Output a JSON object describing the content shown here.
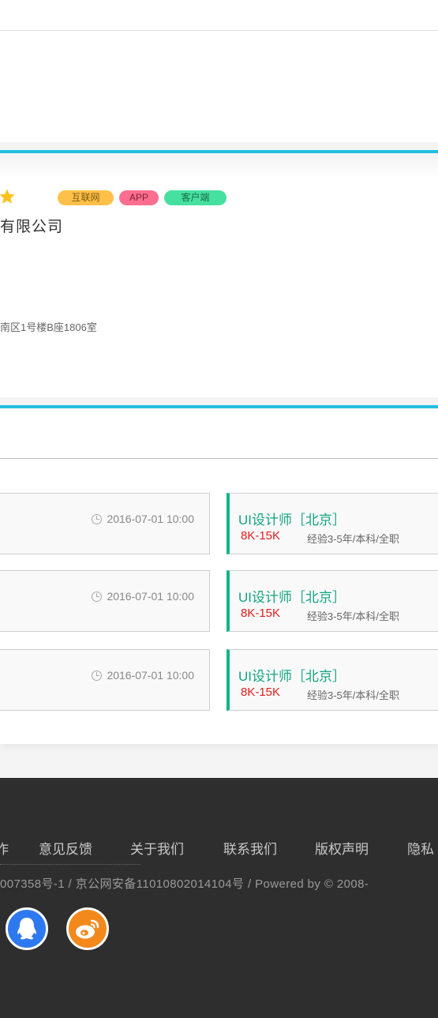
{
  "company": {
    "tags": [
      "互联网",
      "APP",
      "客户端"
    ],
    "name_partial": "有限公司",
    "address_partial": "南区1号楼B座1806室"
  },
  "jobs": {
    "left_items": [
      {
        "time": "2016-07-01 10:00"
      },
      {
        "time": "2016-07-01 10:00"
      },
      {
        "time": "2016-07-01 10:00"
      }
    ],
    "right_items": [
      {
        "title": "UI设计师［北京］",
        "salary": "8K-15K",
        "requirements": "经验3-5年/本科/全职"
      },
      {
        "title": "UI设计师［北京］",
        "salary": "8K-15K",
        "requirements": "经验3-5年/本科/全职"
      },
      {
        "title": "UI设计师［北京］",
        "salary": "8K-15K",
        "requirements": "经验3-5年/本科/全职"
      }
    ]
  },
  "footer": {
    "nav": [
      "作",
      "意见反馈",
      "关于我们",
      "联系我们",
      "版权声明",
      "隐私"
    ],
    "icp": "007358号-1 / 京公网安备11010802014104号 / Powered by © 2008-",
    "social": [
      "qq-icon",
      "weibo-icon"
    ]
  },
  "colors": {
    "accent_blue": "#23bfe0",
    "job_green": "#13a382",
    "salary_red": "#e51b1b",
    "footer_bg": "#2e2e2e"
  }
}
